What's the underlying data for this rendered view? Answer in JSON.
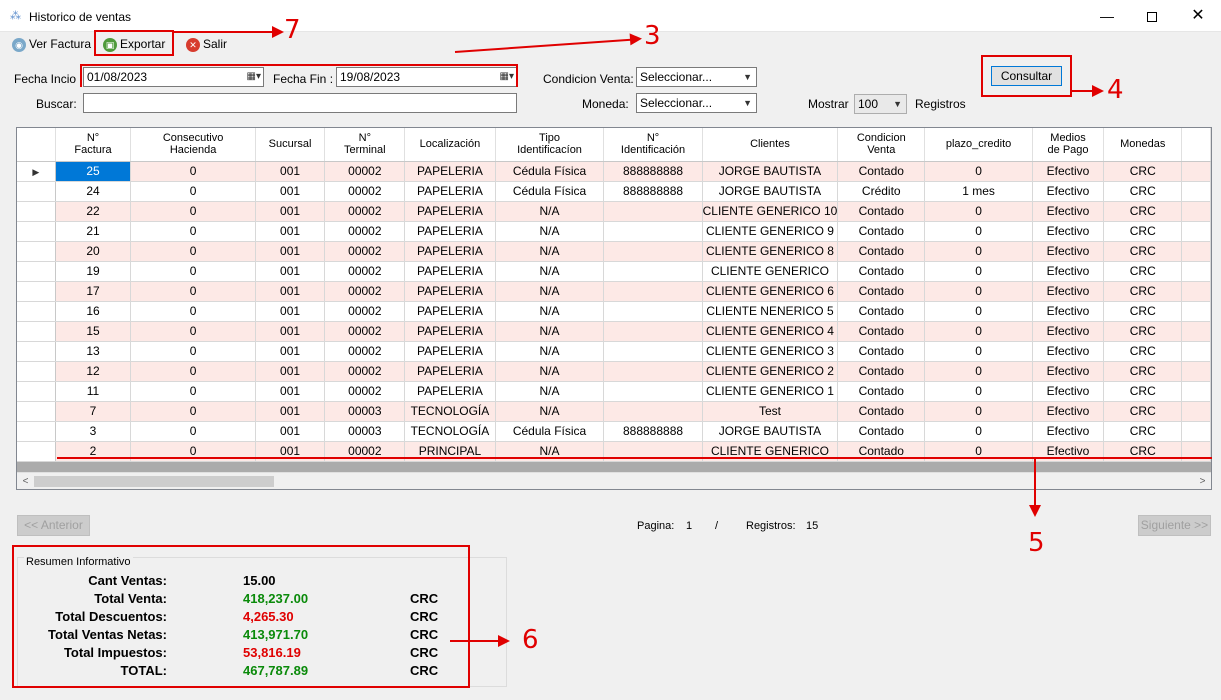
{
  "window": {
    "title": "Historico de ventas",
    "minimize": "—",
    "close": "✕"
  },
  "toolbar": {
    "ver_factura": "Ver Factura",
    "exportar": "Exportar",
    "salir": "Salir"
  },
  "filters": {
    "fecha_inicio_label": "Fecha Incio :",
    "fecha_inicio_value": "01/08/2023",
    "fecha_fin_label": "Fecha Fin :",
    "fecha_fin_value": "19/08/2023",
    "condicion_label": "Condicion Venta:",
    "condicion_value": "Seleccionar...",
    "moneda_label": "Moneda:",
    "moneda_value": "Seleccionar...",
    "buscar_label": "Buscar:",
    "buscar_value": "",
    "mostrar_label": "Mostrar",
    "mostrar_value": "100",
    "registros_label": "Registros",
    "consultar": "Consultar"
  },
  "grid": {
    "columns": [
      "N°\nFactura",
      "Consecutivo\nHacienda",
      "Sucursal",
      "N°\nTerminal",
      "Localización",
      "Tipo\nIdentificacíon",
      "N°\nIdentificación",
      "Clientes",
      "Condicion\nVenta",
      "plazo_credito",
      "Medios\nde Pago",
      "Monedas"
    ],
    "rows": [
      [
        "25",
        "0",
        "001",
        "00002",
        "PAPELERIA",
        "Cédula Física",
        "888888888",
        "JORGE BAUTISTA",
        "Contado",
        "0",
        "Efectivo",
        "CRC"
      ],
      [
        "24",
        "0",
        "001",
        "00002",
        "PAPELERIA",
        "Cédula Física",
        "888888888",
        "JORGE BAUTISTA",
        "Crédito",
        "1 mes",
        "Efectivo",
        "CRC"
      ],
      [
        "22",
        "0",
        "001",
        "00002",
        "PAPELERIA",
        "N/A",
        "",
        "CLIENTE GENERICO 10",
        "Contado",
        "0",
        "Efectivo",
        "CRC"
      ],
      [
        "21",
        "0",
        "001",
        "00002",
        "PAPELERIA",
        "N/A",
        "",
        "CLIENTE GENERICO 9",
        "Contado",
        "0",
        "Efectivo",
        "CRC"
      ],
      [
        "20",
        "0",
        "001",
        "00002",
        "PAPELERIA",
        "N/A",
        "",
        "CLIENTE GENERICO 8",
        "Contado",
        "0",
        "Efectivo",
        "CRC"
      ],
      [
        "19",
        "0",
        "001",
        "00002",
        "PAPELERIA",
        "N/A",
        "",
        "CLIENTE GENERICO",
        "Contado",
        "0",
        "Efectivo",
        "CRC"
      ],
      [
        "17",
        "0",
        "001",
        "00002",
        "PAPELERIA",
        "N/A",
        "",
        "CLIENTE GENERICO 6",
        "Contado",
        "0",
        "Efectivo",
        "CRC"
      ],
      [
        "16",
        "0",
        "001",
        "00002",
        "PAPELERIA",
        "N/A",
        "",
        "CLIENTE NENERICO 5",
        "Contado",
        "0",
        "Efectivo",
        "CRC"
      ],
      [
        "15",
        "0",
        "001",
        "00002",
        "PAPELERIA",
        "N/A",
        "",
        "CLIENTE GENERICO 4",
        "Contado",
        "0",
        "Efectivo",
        "CRC"
      ],
      [
        "13",
        "0",
        "001",
        "00002",
        "PAPELERIA",
        "N/A",
        "",
        "CLIENTE GENERICO 3",
        "Contado",
        "0",
        "Efectivo",
        "CRC"
      ],
      [
        "12",
        "0",
        "001",
        "00002",
        "PAPELERIA",
        "N/A",
        "",
        "CLIENTE GENERICO 2",
        "Contado",
        "0",
        "Efectivo",
        "CRC"
      ],
      [
        "11",
        "0",
        "001",
        "00002",
        "PAPELERIA",
        "N/A",
        "",
        "CLIENTE GENERICO 1",
        "Contado",
        "0",
        "Efectivo",
        "CRC"
      ],
      [
        "7",
        "0",
        "001",
        "00003",
        "TECNOLOGÍA",
        "N/A",
        "",
        "Test",
        "Contado",
        "0",
        "Efectivo",
        "CRC"
      ],
      [
        "3",
        "0",
        "001",
        "00003",
        "TECNOLOGÍA",
        "Cédula Física",
        "888888888",
        "JORGE BAUTISTA",
        "Contado",
        "0",
        "Efectivo",
        "CRC"
      ],
      [
        "2",
        "0",
        "001",
        "00002",
        "PRINCIPAL",
        "N/A",
        "",
        "CLIENTE GENERICO",
        "Contado",
        "0",
        "Efectivo",
        "CRC"
      ]
    ],
    "row_marker": "▶"
  },
  "pager": {
    "anterior": "<< Anterior",
    "siguiente": "Siguiente >>",
    "pagina_label": "Pagina:",
    "pagina_value": "1",
    "separator": "/",
    "registros_label": "Registros:",
    "registros_value": "15"
  },
  "summary": {
    "title": "Resumen Informativo",
    "items": [
      {
        "label": "Cant Ventas:",
        "value": "15.00",
        "currency": "",
        "color": "#000000"
      },
      {
        "label": "Total Venta:",
        "value": "418,237.00",
        "currency": "CRC",
        "color": "#0a8a0a"
      },
      {
        "label": "Total Descuentos:",
        "value": "4,265.30",
        "currency": "CRC",
        "color": "#e00000"
      },
      {
        "label": "Total Ventas Netas:",
        "value": "413,971.70",
        "currency": "CRC",
        "color": "#0a8a0a"
      },
      {
        "label": "Total Impuestos:",
        "value": "53,816.19",
        "currency": "CRC",
        "color": "#e00000"
      },
      {
        "label": "TOTAL:",
        "value": "467,787.89",
        "currency": "CRC",
        "color": "#0a8a0a"
      }
    ]
  },
  "annotations": {
    "n3": "3",
    "n4": "4",
    "n5": "5",
    "n6": "6",
    "n7": "7",
    "color": "#e00000"
  }
}
